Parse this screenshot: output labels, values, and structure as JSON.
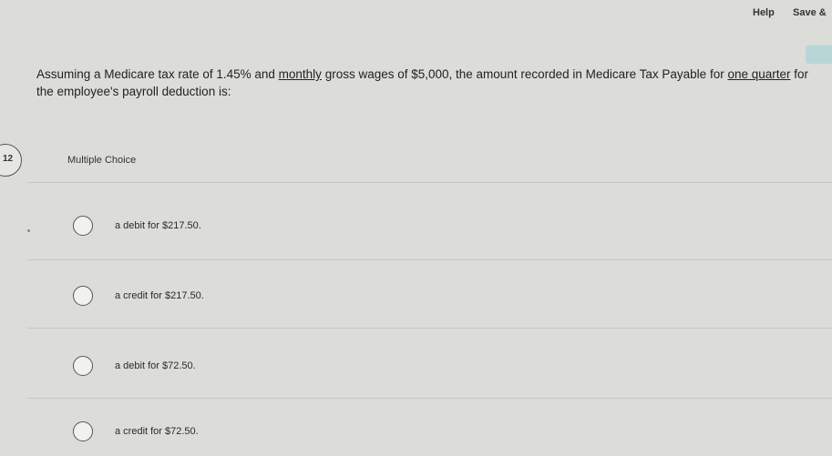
{
  "header": {
    "help_label": "Help",
    "save_label": "Save &"
  },
  "question": {
    "number": "12",
    "text_part1": "Assuming a Medicare tax rate of 1.45% and ",
    "text_monthly": "monthly",
    "text_part2": " gross wages of $5,000, the amount recorded in Medicare Tax Payable for ",
    "text_quarter": "one quarter",
    "text_part3": " for the employee's payroll deduction is:",
    "type_label": "Multiple Choice"
  },
  "choices": [
    {
      "label": "a debit for $217.50."
    },
    {
      "label": "a credit for $217.50."
    },
    {
      "label": "a debit for $72.50."
    },
    {
      "label": "a credit for $72.50."
    }
  ]
}
